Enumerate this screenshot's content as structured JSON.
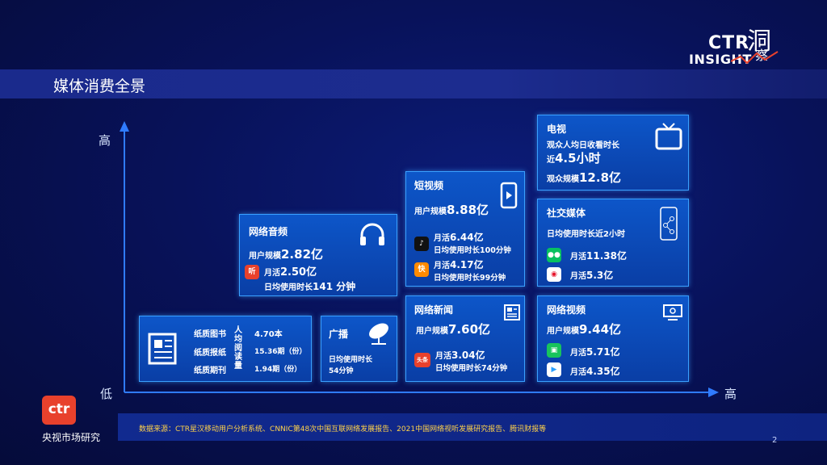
{
  "page": {
    "title": "媒体消费全景",
    "page_number": "2",
    "source": "数据来源：CTR星汉移动用户分析系统、CNNIC第48次中国互联网络发展报告、2021中国网络视听发展研究报告、腾讯财报等"
  },
  "brand": {
    "ctr": "CTR",
    "insight": "INSIGHT",
    "dong": "洞",
    "cha": "察",
    "company_logo": "ctr",
    "company_name": "央视市场研究"
  },
  "axes": {
    "y_high": "高",
    "x_low": "低",
    "x_high": "高"
  },
  "print": {
    "rows": [
      {
        "label": "纸质图书",
        "value": "4.70本"
      },
      {
        "label": "纸质报纸",
        "value": "15.36期（份）"
      },
      {
        "label": "纸质期刊",
        "value": "1.94期（份）"
      }
    ],
    "vertical_label": "人均阅读量"
  },
  "radio": {
    "title": "广播",
    "line1": "日均使用时长",
    "line2": "54分钟"
  },
  "music": {
    "title": "网络音频",
    "scale_label": "用户规模",
    "scale_value": "2.82亿",
    "app_mau_label": "月活",
    "app_mau_value": "2.50亿",
    "app_time_label": "日均使用时长",
    "app_time_value": "141 分钟",
    "app_icon_text": "听"
  },
  "short_video": {
    "title": "短视频",
    "scale_label": "用户规模",
    "scale_value": "8.88亿",
    "apps": [
      {
        "icon": "♪",
        "mau_label": "月活",
        "mau_value": "6.44亿",
        "time": "日均使用时长100分钟"
      },
      {
        "icon": "快",
        "mau_label": "月活",
        "mau_value": "4.17亿",
        "time": "日均使用时长99分钟"
      }
    ]
  },
  "news": {
    "title": "网络新闻",
    "scale_label": "用户规模",
    "scale_value": "7.60亿",
    "app_icon": "头条",
    "mau_label": "月活",
    "mau_value": "3.04亿",
    "time": "日均使用时长74分钟"
  },
  "tv": {
    "title": "电视",
    "line1": "观众人均日收看时长",
    "line2_prefix": "近",
    "line2_value": "4.5小时",
    "scale_label": "观众规模",
    "scale_value": "12.8亿"
  },
  "social": {
    "title": "社交媒体",
    "line1": "日均使用时长近2小时",
    "apps": [
      {
        "mau_label": "月活",
        "mau_value": "11.38亿"
      },
      {
        "mau_label": "月活",
        "mau_value": "5.3亿"
      }
    ]
  },
  "online_video": {
    "title": "网络视频",
    "scale_label": "用户规模",
    "scale_value": "9.44亿",
    "apps": [
      {
        "mau_label": "月活",
        "mau_value": "5.71亿"
      },
      {
        "mau_label": "月活",
        "mau_value": "4.35亿"
      }
    ]
  },
  "colors": {
    "card_border": "#3aa0ff",
    "footer_source": "#ffd24a",
    "brand_red": "#e8412c"
  }
}
